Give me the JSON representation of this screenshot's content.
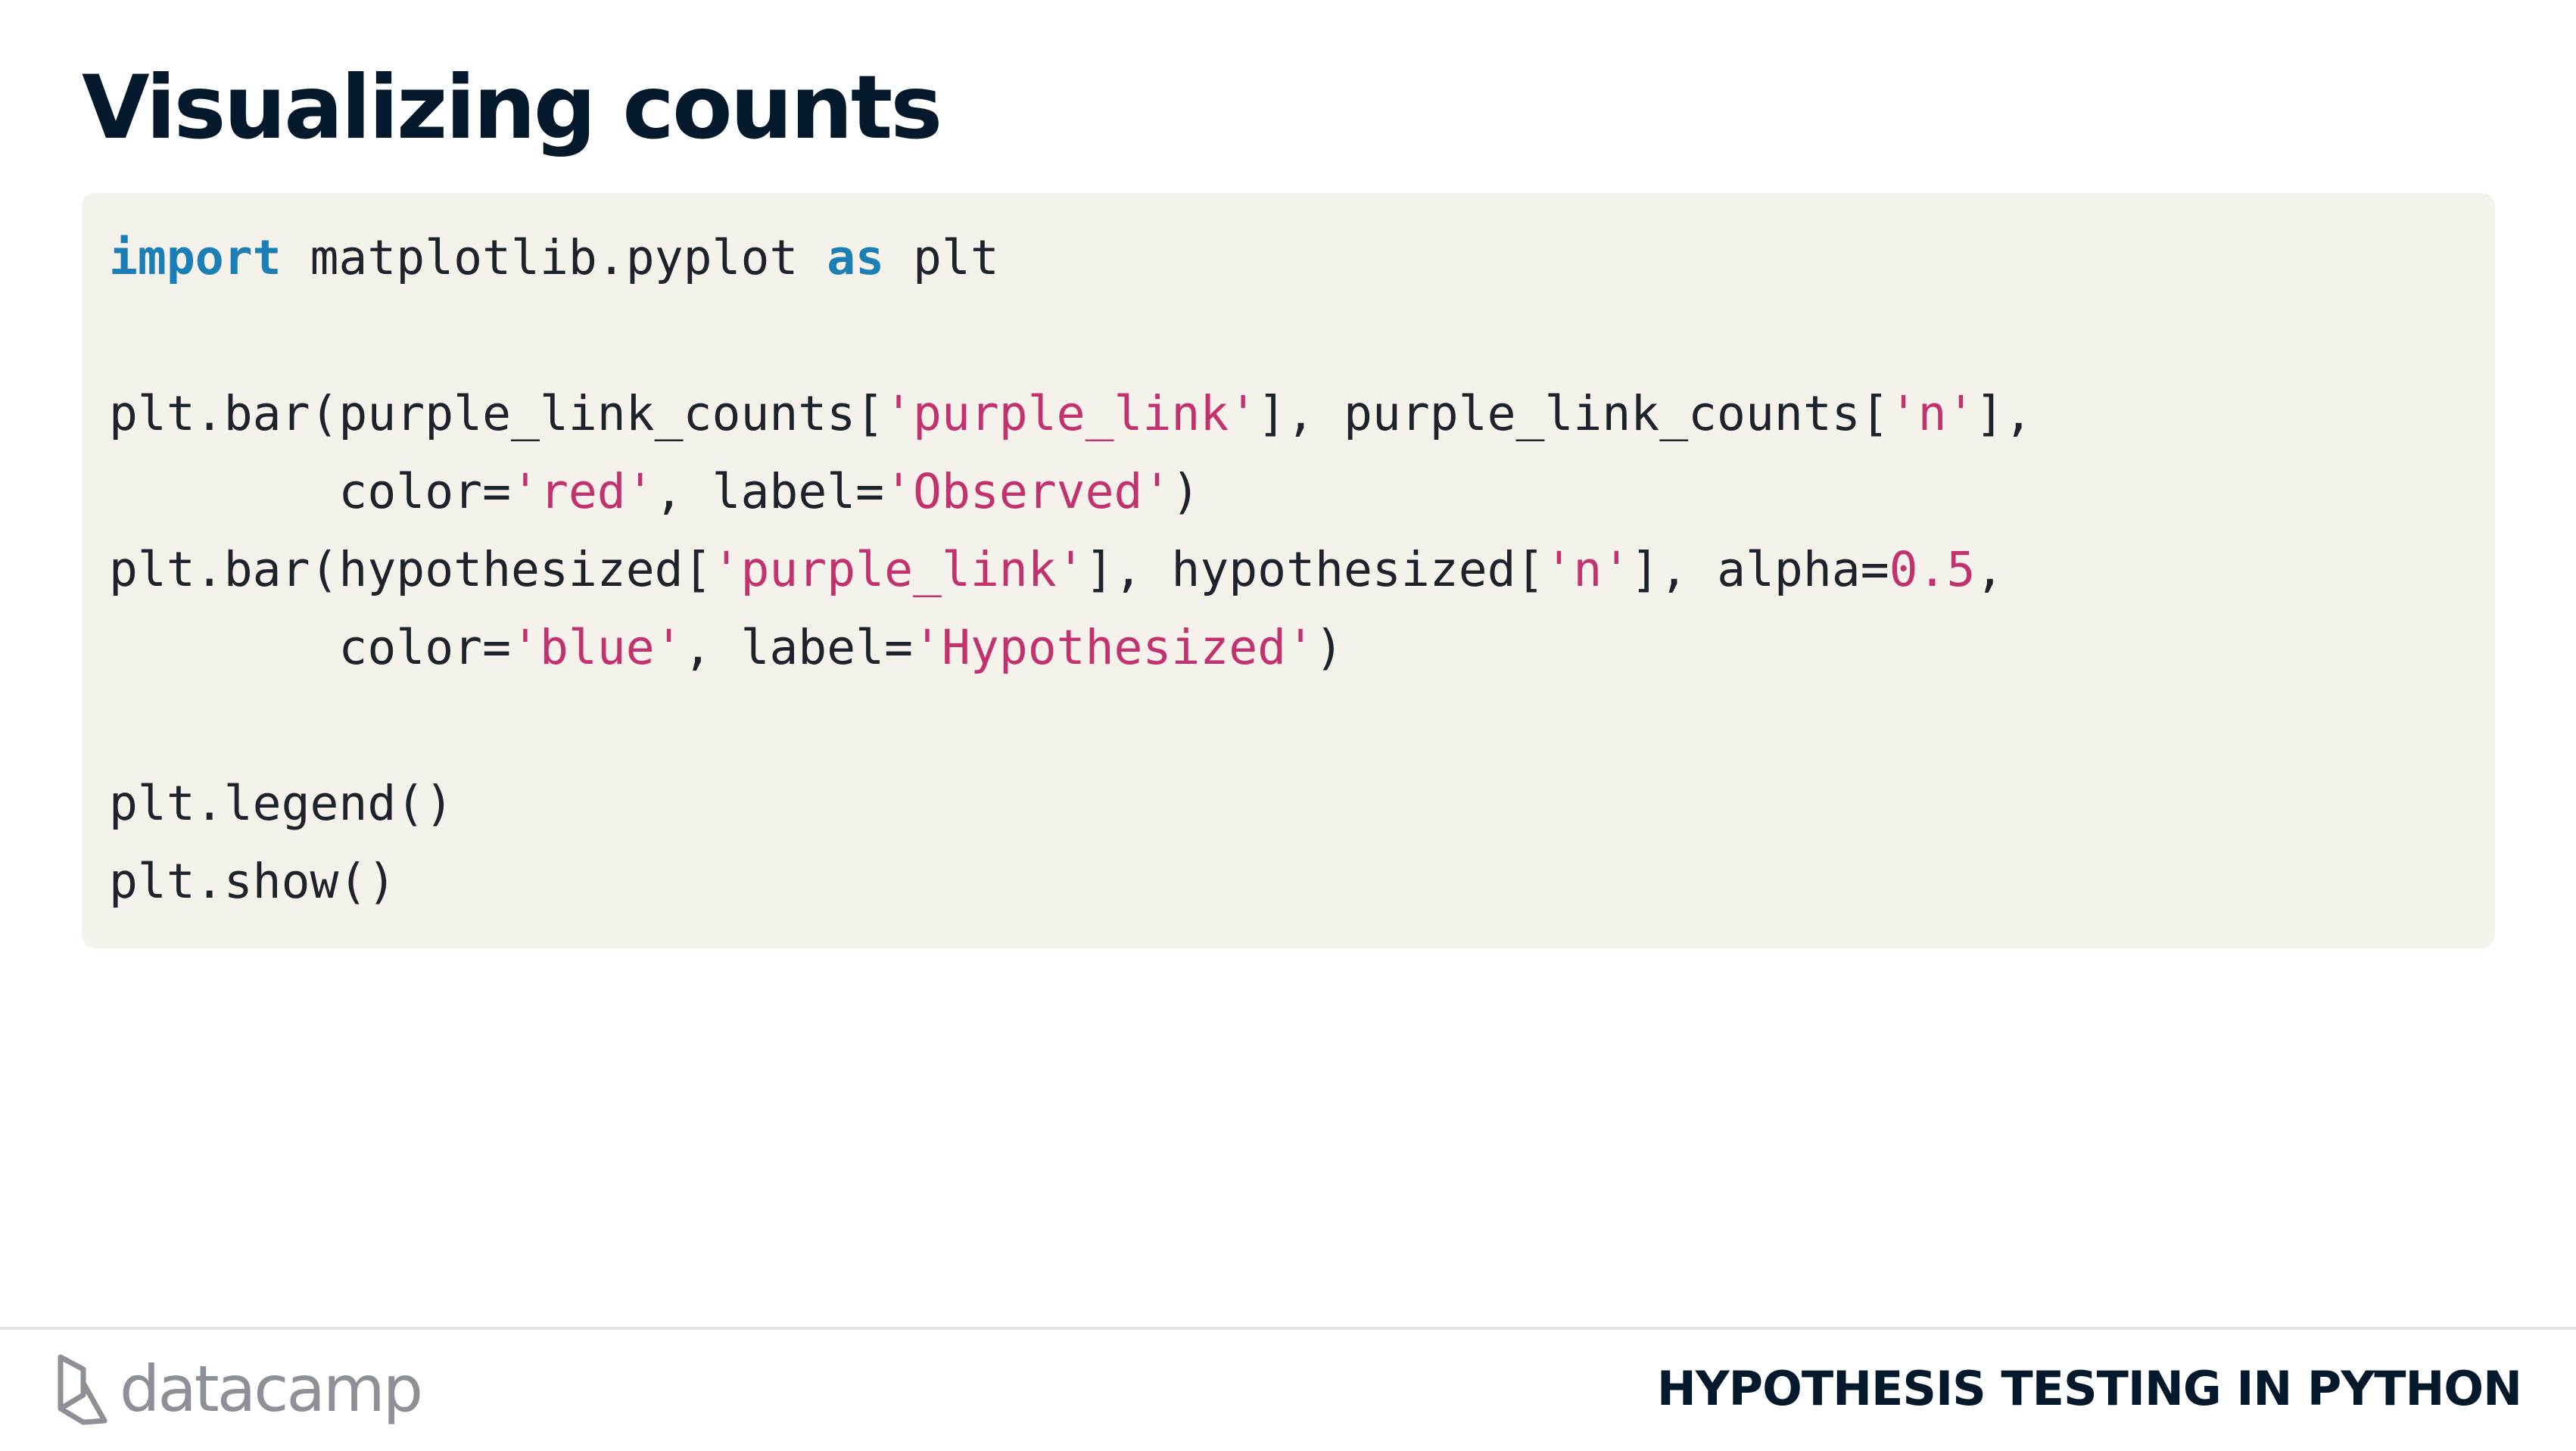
{
  "slide": {
    "title": "Visualizing counts"
  },
  "code": {
    "lines": [
      [
        {
          "t": "import",
          "k": "kw"
        },
        {
          "t": " matplotlib.pyplot ",
          "k": "plain"
        },
        {
          "t": "as",
          "k": "kw"
        },
        {
          "t": " plt",
          "k": "plain"
        }
      ],
      [],
      [
        {
          "t": "plt.bar(purple_link_counts[",
          "k": "plain"
        },
        {
          "t": "'purple_link'",
          "k": "str"
        },
        {
          "t": "], purple_link_counts[",
          "k": "plain"
        },
        {
          "t": "'n'",
          "k": "str"
        },
        {
          "t": "],",
          "k": "plain"
        }
      ],
      [
        {
          "t": "        color=",
          "k": "plain"
        },
        {
          "t": "'red'",
          "k": "str"
        },
        {
          "t": ", label=",
          "k": "plain"
        },
        {
          "t": "'Observed'",
          "k": "str"
        },
        {
          "t": ")",
          "k": "plain"
        }
      ],
      [
        {
          "t": "plt.bar(hypothesized[",
          "k": "plain"
        },
        {
          "t": "'purple_link'",
          "k": "str"
        },
        {
          "t": "], hypothesized[",
          "k": "plain"
        },
        {
          "t": "'n'",
          "k": "str"
        },
        {
          "t": "], alpha=",
          "k": "plain"
        },
        {
          "t": "0.5",
          "k": "num"
        },
        {
          "t": ",",
          "k": "plain"
        }
      ],
      [
        {
          "t": "        color=",
          "k": "plain"
        },
        {
          "t": "'blue'",
          "k": "str"
        },
        {
          "t": ", label=",
          "k": "plain"
        },
        {
          "t": "'Hypothesized'",
          "k": "str"
        },
        {
          "t": ")",
          "k": "plain"
        }
      ],
      [],
      [
        {
          "t": "plt.legend()",
          "k": "plain"
        }
      ],
      [
        {
          "t": "plt.show()",
          "k": "plain"
        }
      ]
    ]
  },
  "footer": {
    "brand": "datacamp",
    "logo_icon": "datacamp-logo-icon",
    "course_name": "HYPOTHESIS TESTING IN PYTHON"
  },
  "colors": {
    "title": "#05192d",
    "code_background": "#f5f2ec",
    "keyword": "#1b7eb5",
    "string": "#c2326e",
    "number": "#c2326e",
    "code_text": "#1e232b",
    "brand_gray": "#8d9096"
  }
}
